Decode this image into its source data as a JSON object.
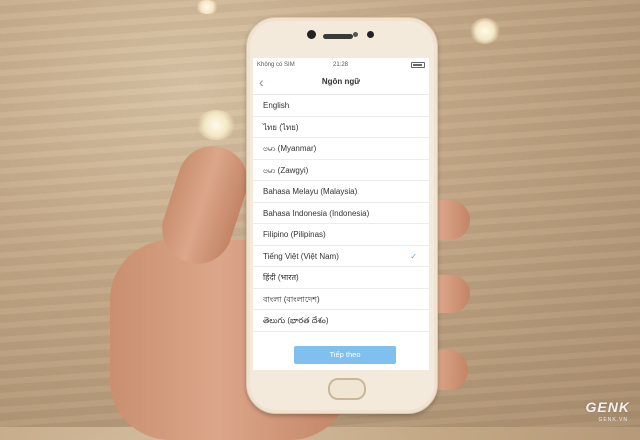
{
  "status_bar": {
    "carrier": "Không có SIM",
    "time": "21:28"
  },
  "header": {
    "title": "Ngôn ngữ",
    "back_icon": "chevron-left-icon"
  },
  "languages": [
    {
      "label": "English",
      "selected": false
    },
    {
      "label": "ไทย (ไทย)",
      "selected": false
    },
    {
      "label": "ဗမာ (Myanmar)",
      "selected": false
    },
    {
      "label": "ဗမာ (Zawgyi)",
      "selected": false
    },
    {
      "label": "Bahasa Melayu (Malaysia)",
      "selected": false
    },
    {
      "label": "Bahasa Indonesia (Indonesia)",
      "selected": false
    },
    {
      "label": "Filipino (Pilipinas)",
      "selected": false
    },
    {
      "label": "Tiếng Việt (Việt Nam)",
      "selected": true
    },
    {
      "label": "हिंदी (भारत)",
      "selected": false
    },
    {
      "label": "বাংলা (বাংলাদেশ)",
      "selected": false
    },
    {
      "label": "తెలుగు (భారత దేశం)",
      "selected": false
    }
  ],
  "check_mark": "✓",
  "next_button": "Tiếp theo",
  "watermark": {
    "brand": "GENK",
    "site": "GENK.VN"
  },
  "colors": {
    "accent": "#7fc0ef",
    "check": "#5aa6e8"
  }
}
